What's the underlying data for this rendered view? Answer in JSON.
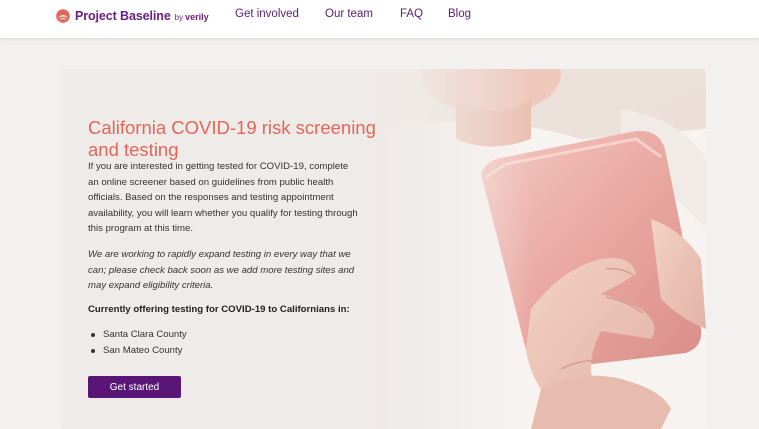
{
  "header": {
    "brand_name": "Project Baseline",
    "brand_by": "by",
    "brand_partner": "verily",
    "logo_icon": "baseline-logo-icon",
    "nav_items": [
      {
        "label": "Get involved"
      },
      {
        "label": "Our team"
      },
      {
        "label": "FAQ"
      },
      {
        "label": "Blog"
      }
    ]
  },
  "hero": {
    "title": "California COVID-19 risk screening and testing",
    "intro": "If you are interested in getting tested for COVID-19, complete an online screener based on guidelines from public health officials. Based on the responses and testing appointment availability, you will learn whether you qualify for testing through this program at this time.",
    "notice": "We are working to rapidly expand testing in every way that we can; please check back soon as we add more testing sites and may expand eligibility criteria.",
    "offering_heading": "Currently offering testing for COVID-19 to Californians in:",
    "counties": [
      "Santa Clara County",
      "San Mateo County"
    ],
    "cta_label": "Get started"
  },
  "colors": {
    "brand": "#6b1f84",
    "title": "#e4665a",
    "button": "#5a1677",
    "background": "#f2f1f0"
  }
}
